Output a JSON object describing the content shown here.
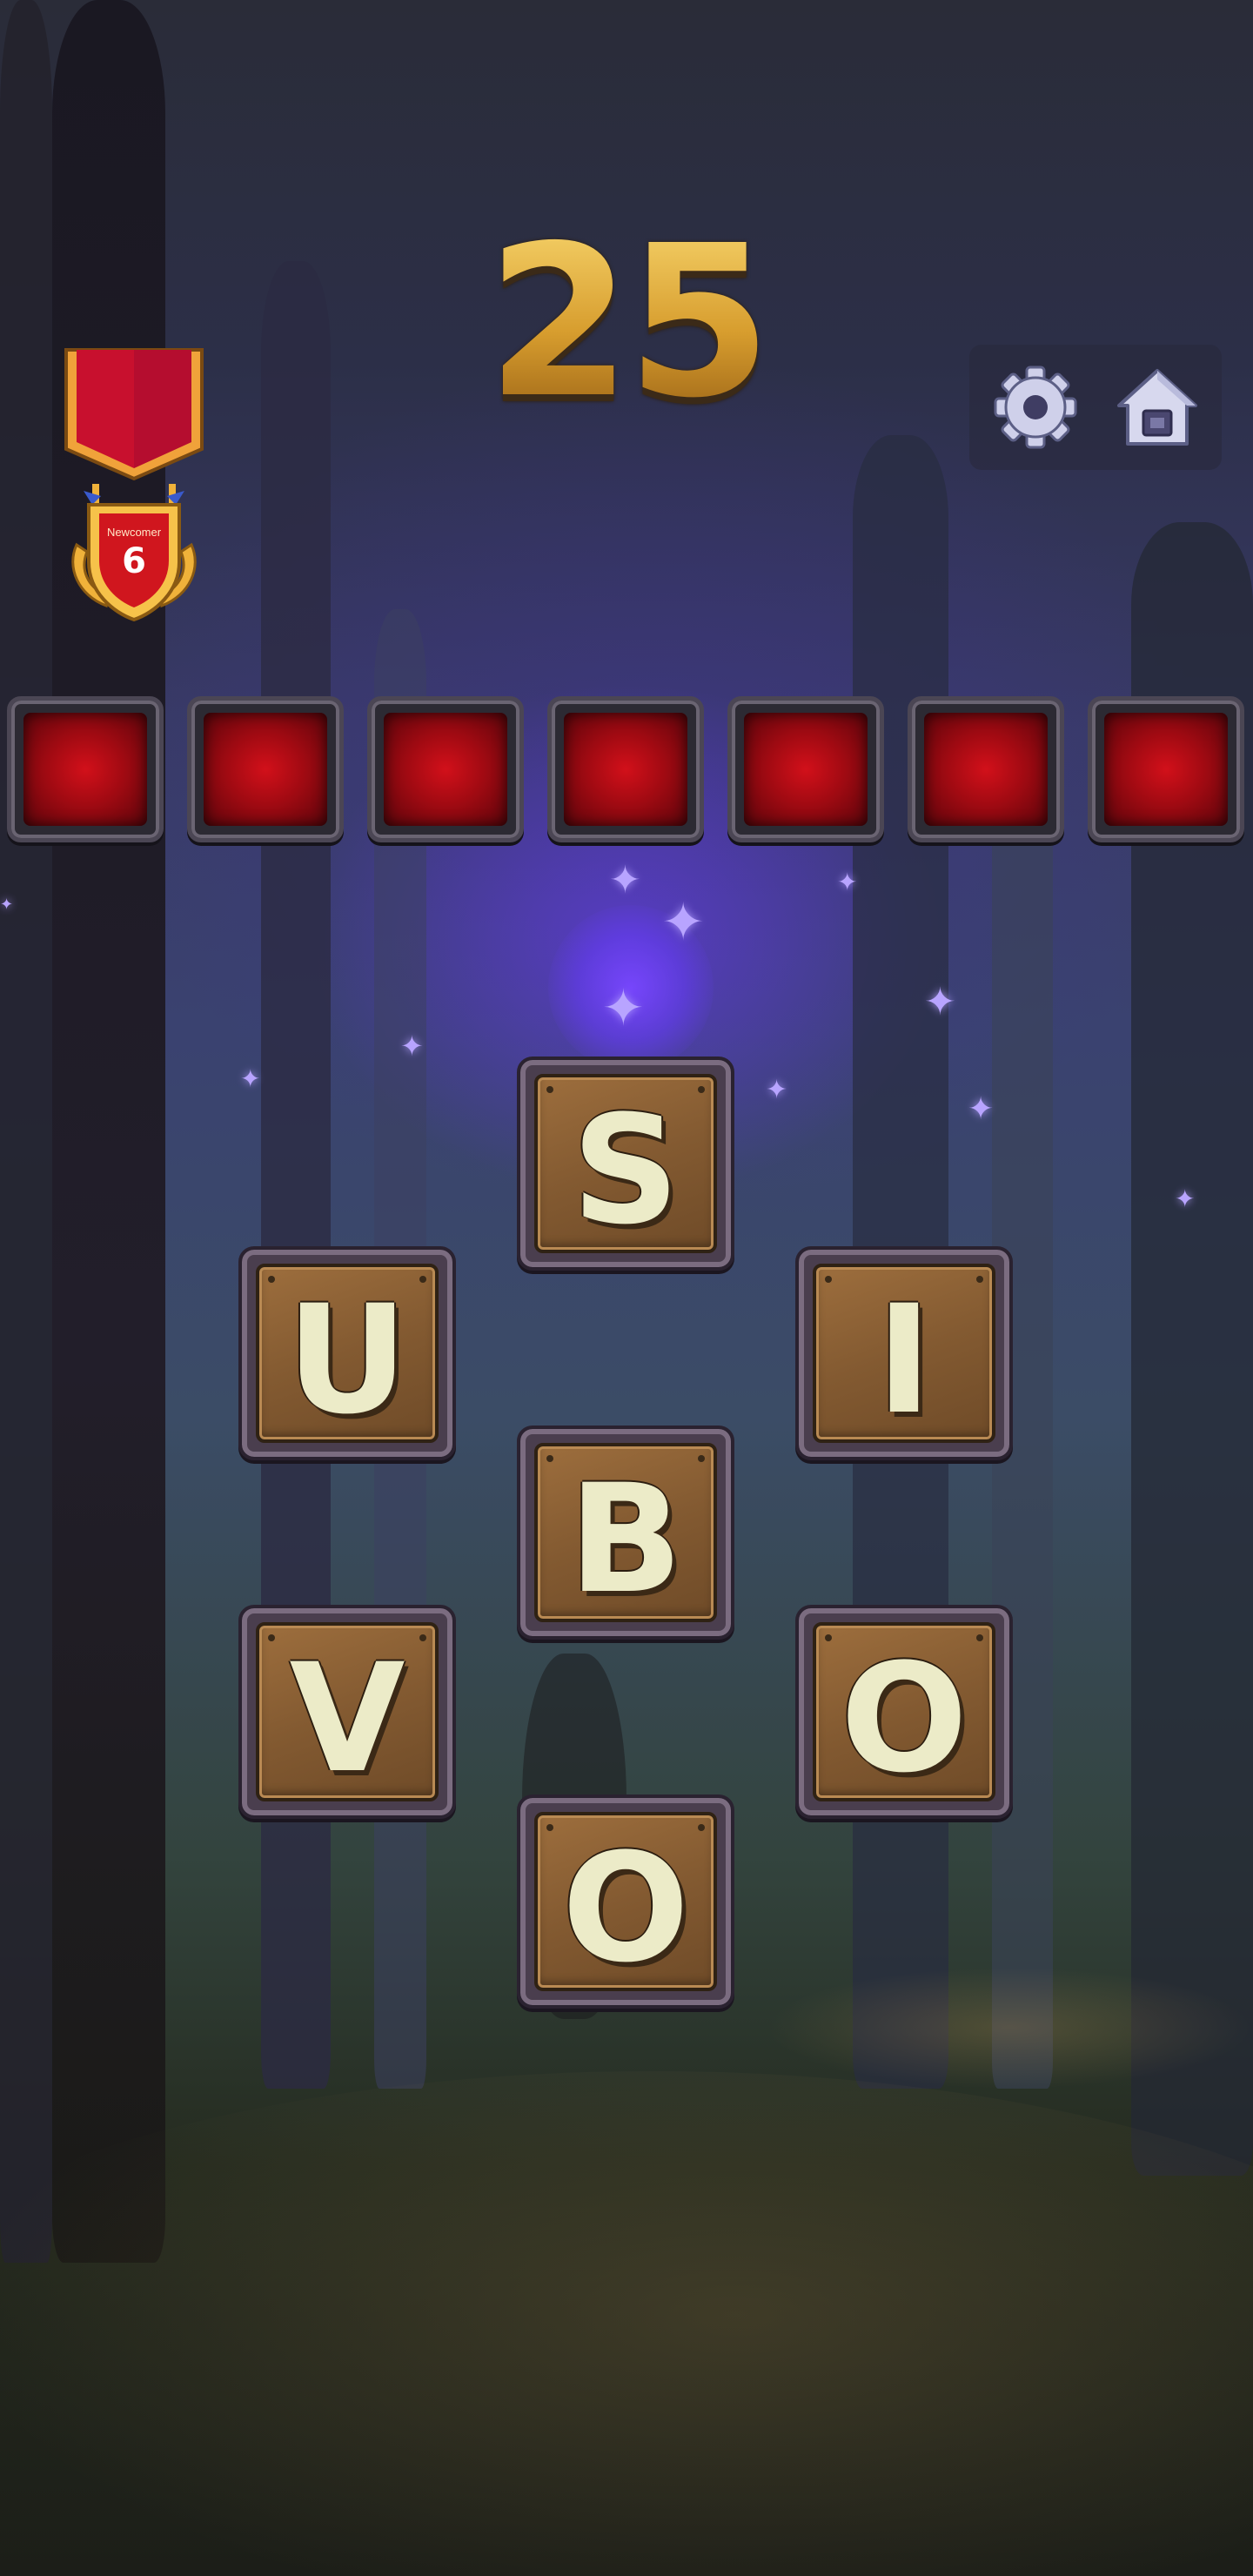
{
  "score": "25",
  "rank": {
    "title": "Newcomer",
    "level": "6"
  },
  "controls": {
    "settings_icon": "gear-icon",
    "home_icon": "home-icon"
  },
  "answer_slots": [
    "",
    "",
    "",
    "",
    "",
    "",
    ""
  ],
  "letters": [
    "S",
    "U",
    "I",
    "B",
    "V",
    "O",
    "O"
  ],
  "colors": {
    "score_gold": "#d9a33a",
    "slot_red": "#c00d17",
    "tile_wood": "#8a5e34",
    "letter_cream": "#ecebc8",
    "glow_purple": "#7a46ff"
  }
}
